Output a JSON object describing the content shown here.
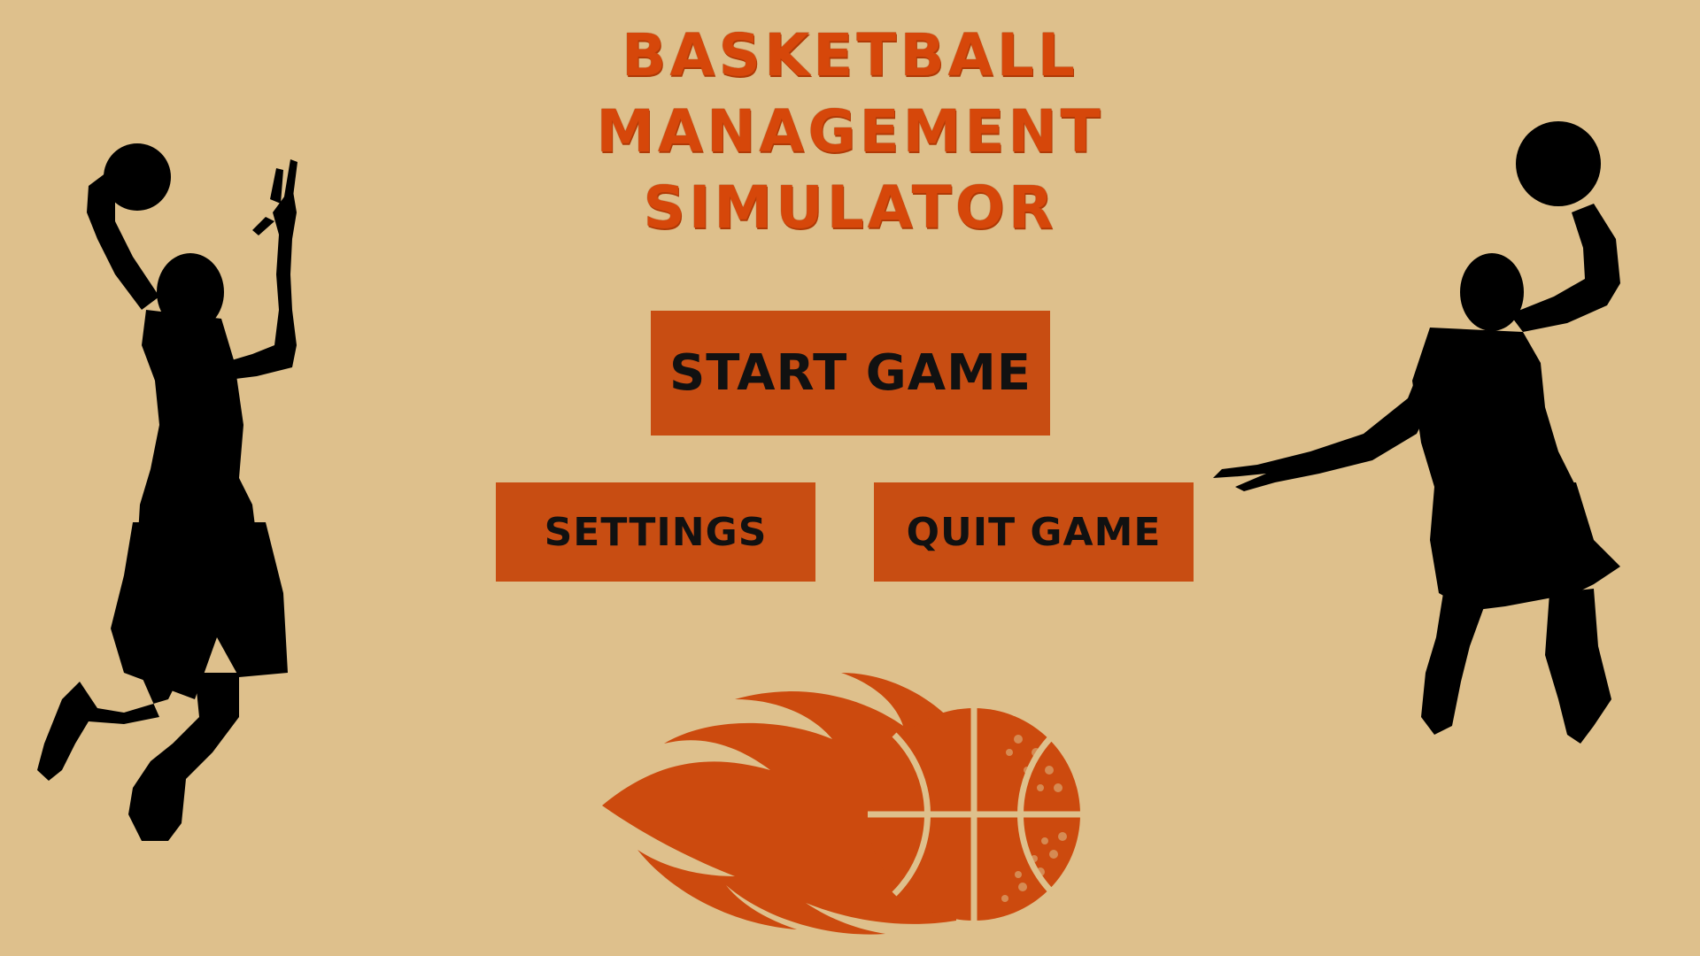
{
  "title": {
    "line1": "BASKETBALL",
    "line2": "MANAGEMENT",
    "line3": "SIMULATOR"
  },
  "menu": {
    "start_label": "START GAME",
    "settings_label": "SETTINGS",
    "quit_label": "QUIT GAME"
  },
  "decor": {
    "left_figure_icon": "basketball-player-silhouette",
    "right_figure_icon": "basketball-player-silhouette",
    "bottom_icon": "flaming-basketball"
  },
  "colors": {
    "background": "#dec08c",
    "title": "#d6470a",
    "button_fill": "#c84d12",
    "button_text": "#111111",
    "silhouette": "#000000",
    "ball": "#cc4a0e"
  }
}
